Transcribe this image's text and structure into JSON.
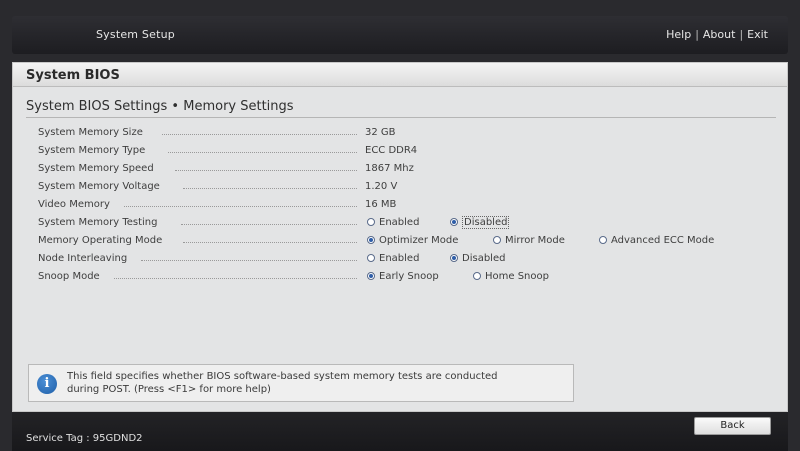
{
  "header": {
    "app_title": "System Setup",
    "links": [
      "Help",
      "About",
      "Exit"
    ]
  },
  "panel": {
    "title": "System BIOS",
    "subtitle": "System BIOS Settings • Memory Settings"
  },
  "settings": [
    {
      "label": "System Memory Size",
      "value": "32 GB"
    },
    {
      "label": "System Memory Type",
      "value": "ECC DDR4"
    },
    {
      "label": "System Memory Speed",
      "value": "1867 Mhz"
    },
    {
      "label": "System Memory Voltage",
      "value": "1.20 V"
    },
    {
      "label": "Video Memory",
      "value": "16 MB"
    },
    {
      "label": "System Memory Testing",
      "options": [
        {
          "label": "Enabled",
          "selected": false
        },
        {
          "label": "Disabled",
          "selected": true,
          "focused": true
        }
      ]
    },
    {
      "label": "Memory Operating Mode",
      "options": [
        {
          "label": "Optimizer Mode",
          "selected": true
        },
        {
          "label": "Mirror Mode",
          "selected": false
        },
        {
          "label": "Advanced ECC Mode",
          "selected": false
        }
      ]
    },
    {
      "label": "Node Interleaving",
      "options": [
        {
          "label": "Enabled",
          "selected": false
        },
        {
          "label": "Disabled",
          "selected": true
        }
      ]
    },
    {
      "label": "Snoop Mode",
      "options": [
        {
          "label": "Early Snoop",
          "selected": true
        },
        {
          "label": "Home Snoop",
          "selected": false
        }
      ]
    }
  ],
  "help": {
    "icon": "info-icon",
    "line1": "This field specifies whether BIOS software-based system memory tests are conducted",
    "line2": "during POST. (Press <F1> for more help)"
  },
  "footer": {
    "service_tag": "Service Tag : 95GDND2",
    "back_label": "Back"
  },
  "colors": {
    "panel_bg": "#e3e4e5",
    "bar_bg": "#1d1d21",
    "radio_selected": "#2f5ea8"
  }
}
